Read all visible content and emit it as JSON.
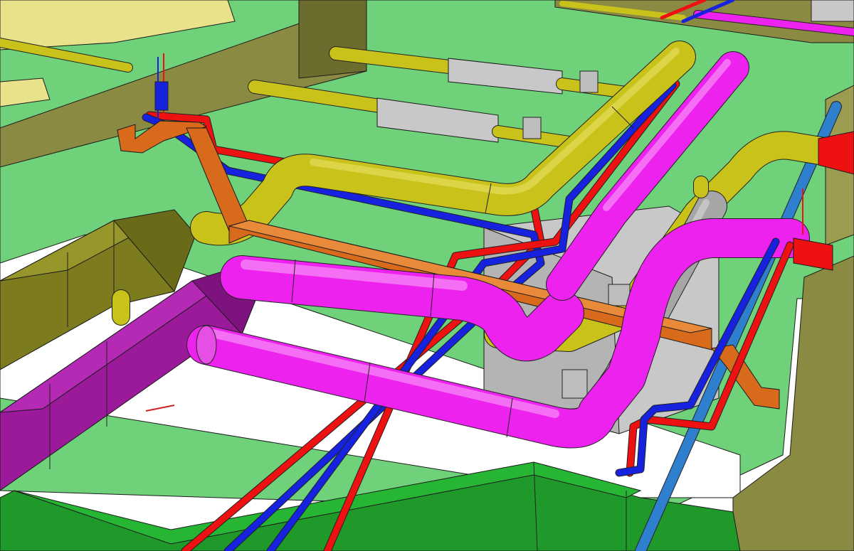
{
  "colors": {
    "slab_green": "#6fd27a",
    "floor_white": "#ffffff",
    "beam_olive": "#8a8a42",
    "beam_olive_dark": "#6c6c2e",
    "ceiling_yellow": "#e8e28a",
    "gas_yellow": "#c9c21a",
    "hot_red": "#ee1111",
    "cold_blue": "#1622dd",
    "magenta": "#ee22ee",
    "magenta_dark": "#b014b0",
    "orange_tray": "#d86a1c",
    "grey_equipment": "#c8c8c8",
    "steel_blue": "#2f7fcf",
    "dark_green_duct": "#1f9a2a",
    "duct_purple": "#9a1a9a",
    "duct_olive": "#7c7c1e"
  },
  "systems": [
    {
      "name": "gas-pipe",
      "color_key": "gas_yellow"
    },
    {
      "name": "supply-duct",
      "color_key": "magenta"
    },
    {
      "name": "hot-water-pipe",
      "color_key": "hot_red"
    },
    {
      "name": "cold-water-pipe",
      "color_key": "cold_blue"
    },
    {
      "name": "cable-tray",
      "color_key": "orange_tray"
    },
    {
      "name": "drain-pipe",
      "color_key": "steel_blue"
    },
    {
      "name": "floor-duct",
      "color_key": "dark_green_duct"
    }
  ]
}
